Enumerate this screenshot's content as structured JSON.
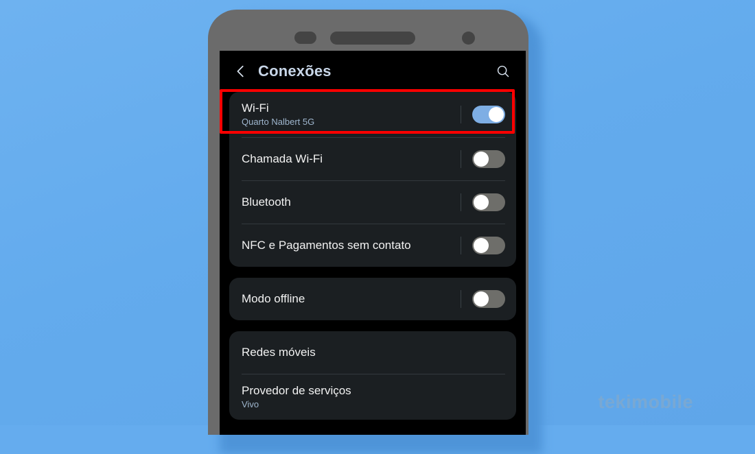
{
  "background": {
    "color_top": "#6EB2F0",
    "color_bottom": "#5FA6E9"
  },
  "watermark": {
    "text": "tekimobile",
    "color": "#7FA9CF"
  },
  "highlight": {
    "color": "#FF0000",
    "target": "Wi-Fi"
  },
  "phone": {
    "frame_color": "#6B6B6B",
    "screen_color": "#000000"
  },
  "header": {
    "title": "Conexões",
    "back_icon": "chevron-left-icon",
    "search_icon": "search-icon",
    "title_color": "#C8D6E8"
  },
  "sections": [
    {
      "rows": [
        {
          "title": "Wi-Fi",
          "subtitle": "Quarto Nalbert 5G",
          "control": "toggle",
          "state": "on",
          "toggle_color": "#7EAEE4"
        },
        {
          "title": "Chamada Wi-Fi",
          "subtitle": "",
          "control": "toggle",
          "state": "off",
          "toggle_color": "#6E6E6A"
        },
        {
          "title": "Bluetooth",
          "subtitle": "",
          "control": "toggle",
          "state": "off",
          "toggle_color": "#6E6E6A"
        },
        {
          "title": "NFC e Pagamentos sem contato",
          "subtitle": "",
          "control": "toggle",
          "state": "off",
          "toggle_color": "#6E6E6A"
        }
      ]
    },
    {
      "rows": [
        {
          "title": "Modo offline",
          "subtitle": "",
          "control": "toggle",
          "state": "off",
          "toggle_color": "#6E6E6A"
        }
      ]
    },
    {
      "rows": [
        {
          "title": "Redes móveis",
          "subtitle": "",
          "control": "none",
          "state": "",
          "toggle_color": ""
        },
        {
          "title": "Provedor de serviços",
          "subtitle": "Vivo",
          "control": "none",
          "state": "",
          "toggle_color": ""
        }
      ]
    }
  ]
}
